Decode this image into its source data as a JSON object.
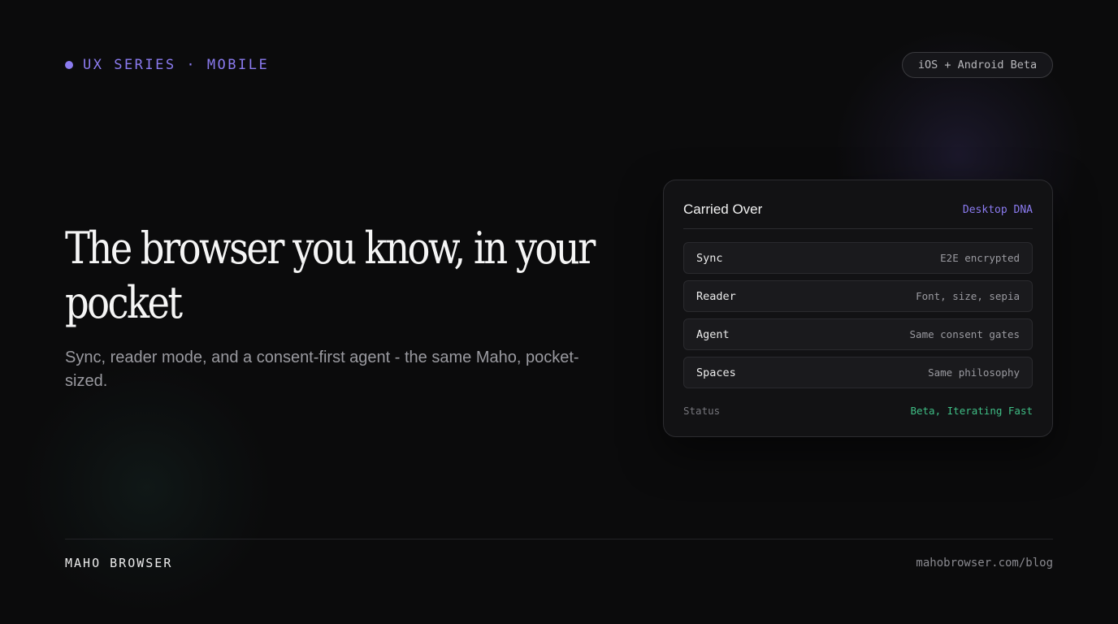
{
  "header": {
    "eyebrow": "UX SERIES · MOBILE",
    "pill": "iOS + Android Beta"
  },
  "hero": {
    "title": "The browser you know, in your pocket",
    "subtitle": "Sync, reader mode, and a consent-first  agent - the same Maho, pocket-sized."
  },
  "card": {
    "title": "Carried Over",
    "tag": "Desktop DNA",
    "rows": [
      {
        "key": "Sync",
        "value": "E2E encrypted"
      },
      {
        "key": "Reader",
        "value": "Font, size, sepia"
      },
      {
        "key": "Agent",
        "value": "Same consent gates"
      },
      {
        "key": "Spaces",
        "value": "Same philosophy"
      }
    ],
    "status": {
      "key": "Status",
      "value": "Beta, Iterating Fast"
    }
  },
  "footer": {
    "brand": "MAHO BROWSER",
    "url": "mahobrowser.com/blog"
  },
  "colors": {
    "accent": "#8b7bf0",
    "status_green": "#3fbf86",
    "background": "#0b0b0c"
  }
}
